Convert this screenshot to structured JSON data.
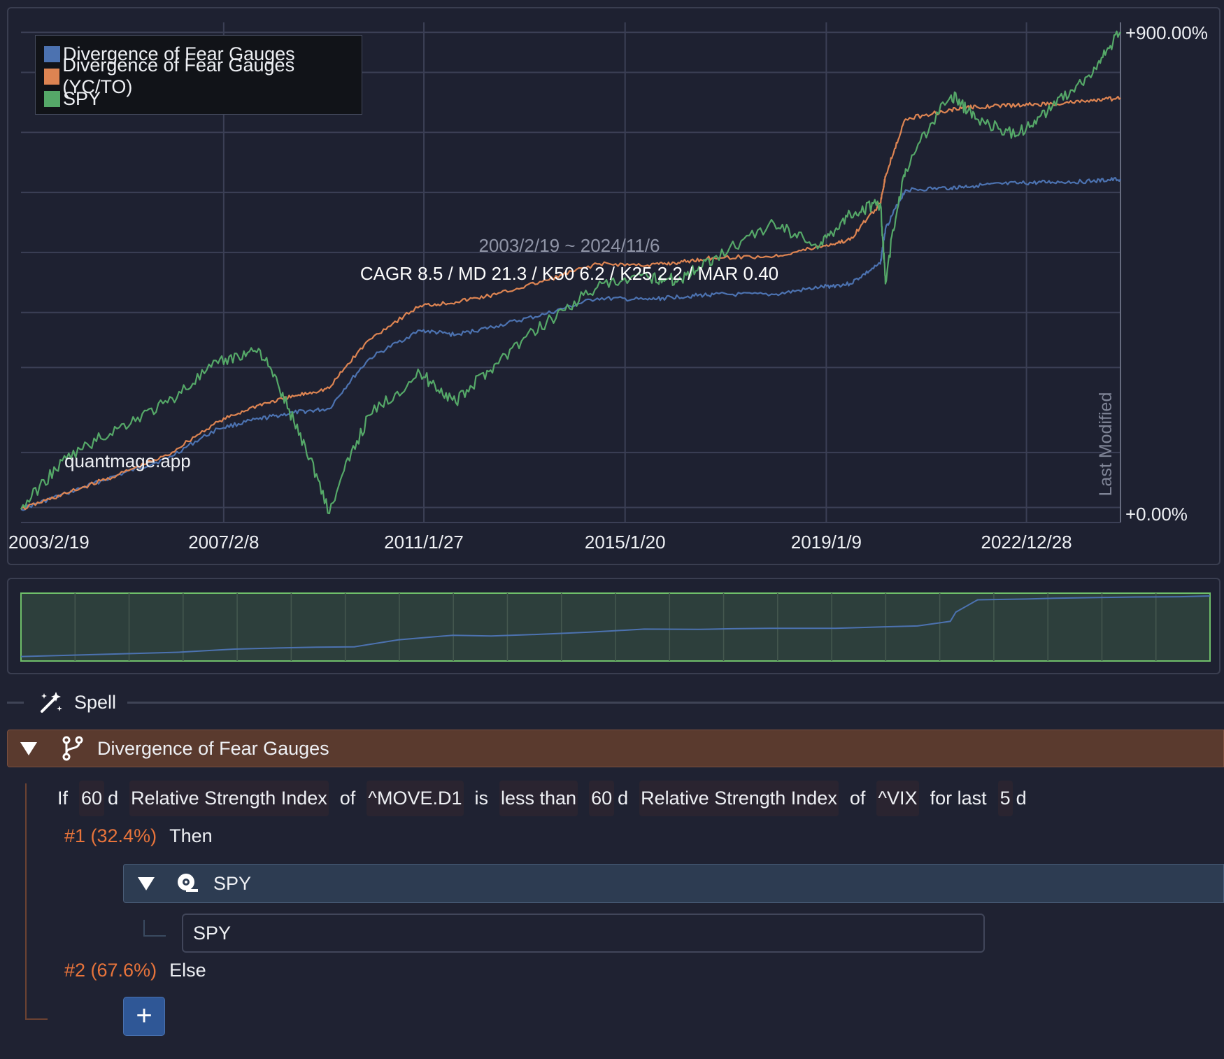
{
  "chart": {
    "watermark": "quantmage.app",
    "vertical_label": "Last Modified",
    "date_range": "2003/2/19 ~ 2024/11/6",
    "stats": "CAGR 8.5 / MD 21.3 / K50 6.2 / K25 2.2 / MAR 0.40",
    "legend": [
      {
        "label": "Divergence of Fear Gauges",
        "color": "#4c72b0"
      },
      {
        "label": "Divergence of Fear Gauges (YC/TO)",
        "color": "#dd8452"
      },
      {
        "label": "SPY",
        "color": "#55a868"
      }
    ]
  },
  "chart_data": {
    "type": "line",
    "x_tick_labels": [
      "2003/2/19",
      "2007/2/8",
      "2011/1/27",
      "2015/1/20",
      "2019/1/9",
      "2022/12/28"
    ],
    "y_tick_labels": [
      "+900.00%",
      "+0.00%"
    ],
    "ylim": [
      0,
      900
    ],
    "y_scale": "log",
    "grid": true,
    "legend_position": "top-left",
    "x": [
      2003.1,
      2004.0,
      2005.0,
      2006.0,
      2007.0,
      2007.8,
      2008.5,
      2009.2,
      2010.0,
      2011.0,
      2011.7,
      2012.5,
      2013.5,
      2014.5,
      2015.5,
      2016.1,
      2016.8,
      2018.0,
      2018.9,
      2019.5,
      2020.1,
      2020.2,
      2020.6,
      2021.5,
      2022.0,
      2022.8,
      2023.5,
      2024.3,
      2024.85
    ],
    "series": [
      {
        "name": "Divergence of Fear Gauges",
        "color": "#4c72b0",
        "values": [
          2,
          10,
          20,
          30,
          50,
          57,
          62,
          65,
          110,
          140,
          135,
          145,
          160,
          180,
          178,
          182,
          185,
          185,
          195,
          200,
          230,
          290,
          370,
          375,
          380,
          385,
          388,
          390,
          395
        ]
      },
      {
        "name": "Divergence of Fear Gauges (YC/TO)",
        "color": "#dd8452",
        "values": [
          2,
          10,
          20,
          32,
          55,
          68,
          75,
          82,
          130,
          170,
          175,
          185,
          205,
          230,
          228,
          232,
          240,
          242,
          258,
          270,
          340,
          400,
          560,
          590,
          600,
          605,
          610,
          620,
          630
        ]
      },
      {
        "name": "SPY",
        "color": "#55a868",
        "values": [
          2,
          30,
          50,
          70,
          105,
          120,
          55,
          0,
          60,
          95,
          70,
          105,
          150,
          195,
          210,
          205,
          240,
          300,
          260,
          320,
          340,
          200,
          420,
          640,
          560,
          510,
          600,
          720,
          900
        ]
      }
    ]
  },
  "spell": {
    "label": "Spell"
  },
  "group": {
    "title": "Divergence of Fear Gauges"
  },
  "condition": {
    "if": "If",
    "left_period": "60",
    "left_unit": "d",
    "left_indicator": "Relative Strength Index",
    "of1": "of",
    "left_ticker": "^MOVE.D1",
    "is": "is",
    "comparator": "less than",
    "right_period": "60",
    "right_unit": "d",
    "right_indicator": "Relative Strength Index",
    "of2": "of",
    "right_ticker": "^VIX",
    "for_last": "for last",
    "window": "5",
    "window_unit": "d"
  },
  "branches": [
    {
      "pct": "#1 (32.4%)",
      "label": "Then"
    },
    {
      "pct": "#2 (67.6%)",
      "label": "Else"
    }
  ],
  "asset": {
    "title": "SPY",
    "input_value": "SPY"
  },
  "add_button": {
    "label": "+"
  }
}
